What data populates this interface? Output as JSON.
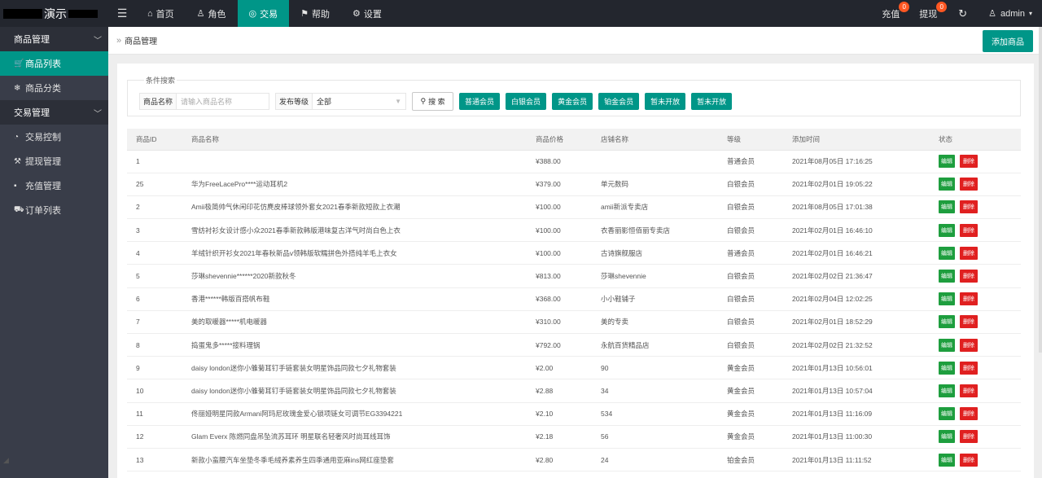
{
  "app": {
    "title": "演示"
  },
  "nav": [
    {
      "icon": "hamburger-icon",
      "label": ""
    },
    {
      "icon": "home-icon",
      "label": "首页"
    },
    {
      "icon": "user-icon",
      "label": "角色"
    },
    {
      "icon": "coins-icon",
      "label": "交易",
      "active": true
    },
    {
      "icon": "flag-icon",
      "label": "帮助"
    },
    {
      "icon": "gear-icon",
      "label": "设置"
    }
  ],
  "topright": {
    "recharge": {
      "label": "充值",
      "badge": "0"
    },
    "withdraw": {
      "label": "提现",
      "badge": "0"
    },
    "user": "admin"
  },
  "sidebar": {
    "groups": [
      {
        "label": "商品管理",
        "items": [
          {
            "label": "商品列表",
            "icon": "cart-icon",
            "active": true
          },
          {
            "label": "商品分类",
            "icon": "snowflake-icon"
          }
        ]
      },
      {
        "label": "交易管理",
        "items": [
          {
            "label": "交易控制",
            "icon": "gauge-icon"
          },
          {
            "label": "提现管理",
            "icon": "gavel-icon"
          },
          {
            "label": "充值管理",
            "icon": "comment-icon"
          },
          {
            "label": "订单列表",
            "icon": "cart-outline-icon"
          }
        ]
      }
    ]
  },
  "breadcrumb": "商品管理",
  "add_button": "添加商品",
  "search": {
    "legend": "条件搜索",
    "name_label": "商品名称",
    "name_placeholder": "请输入商品名称",
    "level_label": "发布等级",
    "level_value": "全部",
    "search_button": "搜 索",
    "level_buttons": [
      "普通会员",
      "白银会员",
      "黄金会员",
      "铂金会员",
      "暂未开放",
      "暂未开放"
    ]
  },
  "table": {
    "columns": [
      "商品ID",
      "商品名称",
      "商品价格",
      "店铺名称",
      "等级",
      "添加时间",
      "状态"
    ],
    "edit_label": "编辑",
    "delete_label": "删除",
    "rows": [
      {
        "id": "1",
        "name": "",
        "price": "¥388.00",
        "shop": "",
        "level": "普通会员",
        "time": "2021年08月05日 17:16:25"
      },
      {
        "id": "25",
        "name": "华为FreeLacePro****运动耳机2",
        "price": "¥379.00",
        "shop": "单元数码",
        "level": "白银会员",
        "time": "2021年02月01日 19:05:22"
      },
      {
        "id": "2",
        "name": "Amii极简帅气休闲印花仿麂皮棒球领外套女2021春季新款短款上衣潮",
        "price": "¥100.00",
        "shop": "amii新派专卖店",
        "level": "白银会员",
        "time": "2021年08月05日 17:01:38"
      },
      {
        "id": "3",
        "name": "雪纺衬衫女设计感小众2021春季新款韩版港味复古洋气时尚白色上衣",
        "price": "¥100.00",
        "shop": "衣香丽影恒佰丽专卖店",
        "level": "白银会员",
        "time": "2021年02月01日 16:46:10"
      },
      {
        "id": "4",
        "name": "羊绒针织开衫女2021年春秋新品v领韩版软糯拼色外搭纯羊毛上衣女",
        "price": "¥100.00",
        "shop": "古诗旗舰服店",
        "level": "普通会员",
        "time": "2021年02月01日 16:46:21"
      },
      {
        "id": "5",
        "name": "莎琳shevennie******2020新款秋冬",
        "price": "¥813.00",
        "shop": "莎琳shevennie",
        "level": "白银会员",
        "time": "2021年02月02日 21:36:47"
      },
      {
        "id": "6",
        "name": "香港******韩版百搭帆布鞋",
        "price": "¥368.00",
        "shop": "小小鞋铺子",
        "level": "白银会员",
        "time": "2021年02月04日 12:02:25"
      },
      {
        "id": "7",
        "name": "美的取暖器*****机电暖器",
        "price": "¥310.00",
        "shop": "美的专卖",
        "level": "白银会员",
        "time": "2021年02月01日 18:52:29"
      },
      {
        "id": "8",
        "name": "捣蛋鬼多*****接料理锅",
        "price": "¥792.00",
        "shop": "永航百货精品店",
        "level": "白银会员",
        "time": "2021年02月02日 21:32:52"
      },
      {
        "id": "9",
        "name": "daisy london迷你小雏菊耳钉手链套装女明星饰品同款七夕礼物套装",
        "price": "¥2.00",
        "shop": "90",
        "level": "黄金会员",
        "time": "2021年01月13日 10:56:01"
      },
      {
        "id": "10",
        "name": "daisy london迷你小雏菊耳钉手链套装女明星饰品同款七夕礼物套装",
        "price": "¥2.88",
        "shop": "34",
        "level": "黄金会员",
        "time": "2021年01月13日 10:57:04"
      },
      {
        "id": "11",
        "name": "佟丽娅明星同款Armani阿玛尼玫瑰金爱心锁项链女可调节EG3394221",
        "price": "¥2.10",
        "shop": "534",
        "level": "黄金会员",
        "time": "2021年01月13日 11:16:09"
      },
      {
        "id": "12",
        "name": "Glam Everx 陈燃同盘吊坠流苏耳环 明星联名轻奢风时尚耳线耳饰",
        "price": "¥2.18",
        "shop": "56",
        "level": "黄金会员",
        "time": "2021年01月13日 11:00:30"
      },
      {
        "id": "13",
        "name": "新款小蛮腰汽车坐垫冬季毛绒养素养生四季通用亚麻ins网红座垫套",
        "price": "¥2.80",
        "shop": "24",
        "level": "铂金会员",
        "time": "2021年01月13日 11:11:52"
      }
    ]
  }
}
